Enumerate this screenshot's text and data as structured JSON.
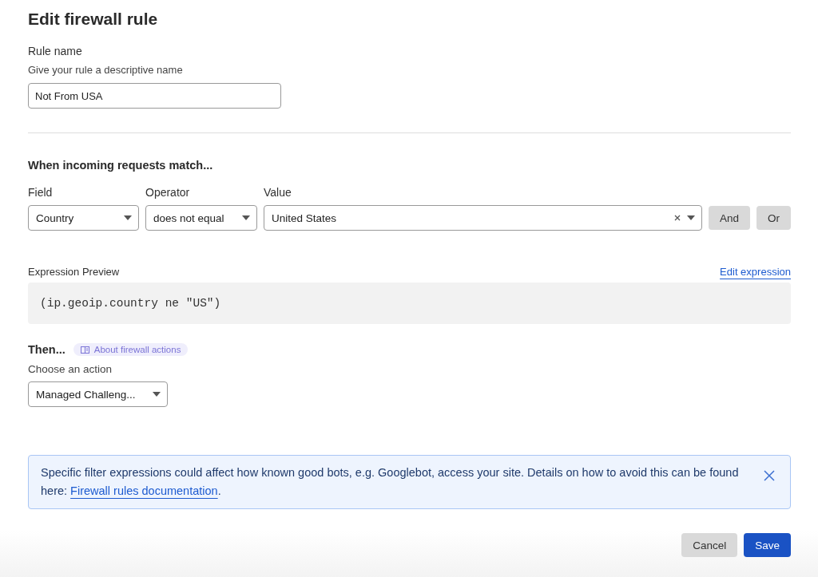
{
  "title": "Edit firewall rule",
  "rule_name": {
    "label": "Rule name",
    "hint": "Give your rule a descriptive name",
    "value": "Not From USA"
  },
  "match": {
    "heading": "When incoming requests match...",
    "columns": [
      {
        "label": "Field",
        "value": "Country",
        "kind": "select"
      },
      {
        "label": "Operator",
        "value": "does not equal",
        "kind": "select"
      },
      {
        "label": "Value",
        "value": "United States",
        "kind": "clearable"
      }
    ],
    "buttons": [
      "And",
      "Or"
    ]
  },
  "preview": {
    "label": "Expression Preview",
    "link": "Edit expression",
    "code": "(ip.geoip.country ne \"US\")"
  },
  "then": {
    "heading": "Then...",
    "badge": "About firewall actions",
    "label": "Choose an action",
    "value": "Managed Challeng..."
  },
  "notice": {
    "text": "Specific filter expressions could affect how known good bots, e.g. Googlebot, access your site. Details on how to avoid this can be found here: ",
    "link": "Firewall rules documentation",
    "after": "."
  },
  "actions": [
    {
      "label": "Cancel",
      "kind": "secondary"
    },
    {
      "label": "Save",
      "kind": "primary"
    }
  ]
}
